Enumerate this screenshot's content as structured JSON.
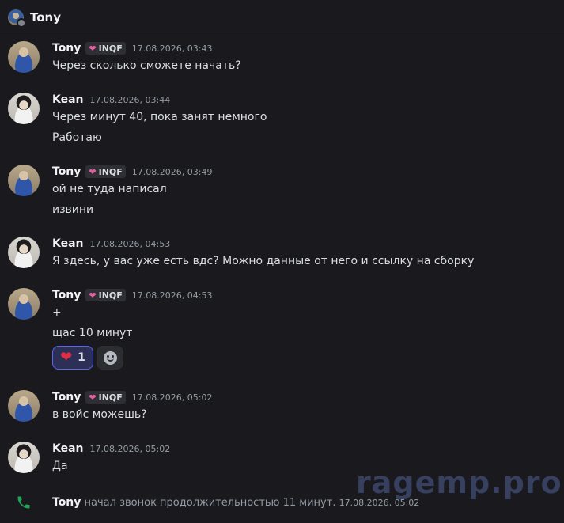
{
  "header": {
    "title": "Tony"
  },
  "messages": [
    {
      "author": "Tony",
      "tag": "INQF",
      "timestamp": "17.08.2026, 03:43",
      "lines": [
        "Через сколько сможете начать?"
      ]
    },
    {
      "author": "Kean",
      "timestamp": "17.08.2026, 03:44",
      "lines": [
        "Через минут 40, пока занят немного",
        "Работаю"
      ]
    },
    {
      "author": "Tony",
      "tag": "INQF",
      "timestamp": "17.08.2026, 03:49",
      "lines": [
        "ой не туда написал",
        "извини"
      ]
    },
    {
      "author": "Kean",
      "timestamp": "17.08.2026, 04:53",
      "lines": [
        "Я здесь, у вас уже есть вдс? Можно данные от него и ссылку на сборку"
      ]
    },
    {
      "author": "Tony",
      "tag": "INQF",
      "timestamp": "17.08.2026, 04:53",
      "lines": [
        "+",
        "щас 10 минут"
      ],
      "reaction": {
        "emoji": "heart",
        "count": "1"
      }
    },
    {
      "author": "Tony",
      "tag": "INQF",
      "timestamp": "17.08.2026, 05:02",
      "lines": [
        "в войс можешь?"
      ]
    },
    {
      "author": "Kean",
      "timestamp": "17.08.2026, 05:02",
      "lines": [
        "Да"
      ]
    }
  ],
  "call": {
    "author": "Tony",
    "text": " начал звонок продолжительностью 11 минут. ",
    "timestamp": "17.08.2026, 05:02"
  },
  "watermark": "ragemp.pro",
  "colors": {
    "background": "#1a1a1e",
    "accent": "#5865f2",
    "tag_heart": "#e45ea4",
    "call_green": "#23a55a"
  }
}
